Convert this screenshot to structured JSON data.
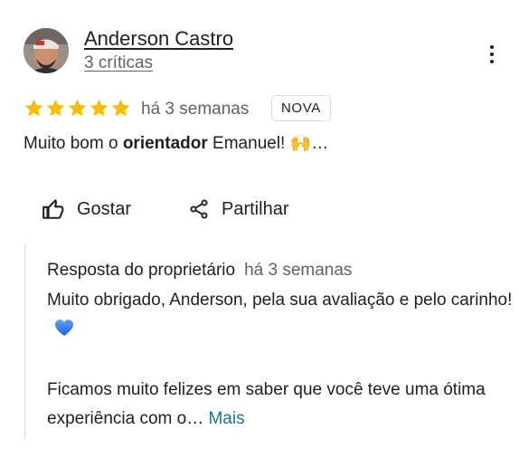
{
  "reviewer": {
    "name": "Anderson Castro",
    "review_count": "3 críticas",
    "avatar_icon": "user-avatar-photo"
  },
  "review": {
    "rating": 5,
    "max_rating": 5,
    "star_color": "#fbbc04",
    "time_ago": "há 3 semanas",
    "badge": "NOVA",
    "text_before": "Muito bom o ",
    "text_bold": "orientador",
    "text_after": " Emanuel!",
    "emoji": "🙌",
    "ellipsis": "…"
  },
  "actions": {
    "like_label": "Gostar",
    "like_icon": "thumbs-up-icon",
    "share_label": "Partilhar",
    "share_icon": "share-icon"
  },
  "owner_reply": {
    "label": "Resposta do proprietário",
    "time_ago": "há 3 semanas",
    "paragraph1": "Muito obrigado, Anderson, pela sua avaliação e pelo carinho!",
    "heart_icon": "blue-heart-icon",
    "heart_color": "#3b82f6",
    "paragraph2": "Ficamos muito felizes em saber que você teve uma ótima experiência com o…",
    "more_label": "Mais",
    "more_color": "#127a8a"
  },
  "menu": {
    "icon": "more-vert-icon"
  }
}
